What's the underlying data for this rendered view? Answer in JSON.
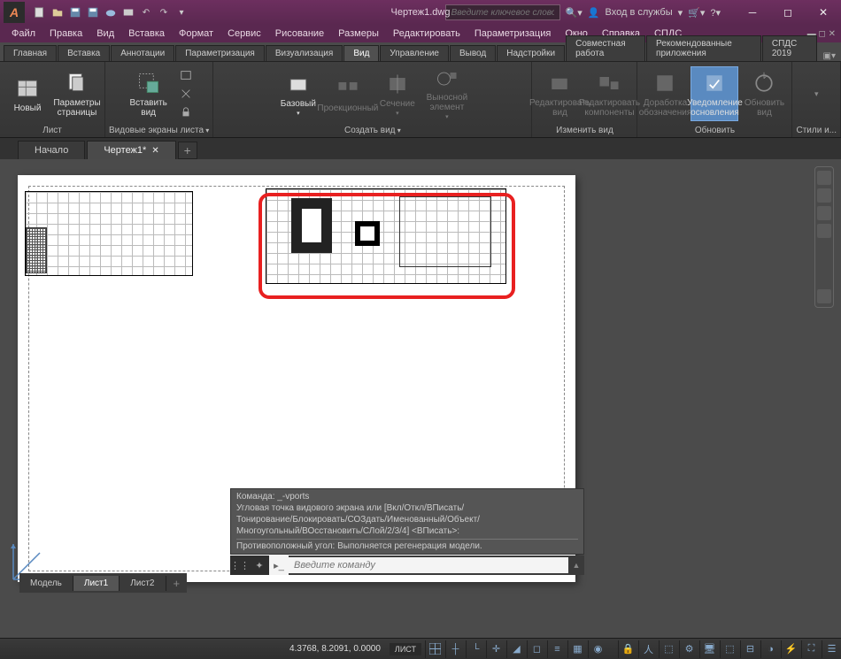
{
  "title": "Чертеж1.dwg",
  "search_placeholder": "Введите ключевое слово/фразу",
  "login_label": "Вход в службы",
  "menu": [
    "Файл",
    "Правка",
    "Вид",
    "Вставка",
    "Формат",
    "Сервис",
    "Рисование",
    "Размеры",
    "Редактировать",
    "Параметризация",
    "Окно",
    "Справка",
    "СПДС"
  ],
  "ribbon_tabs": [
    "Главная",
    "Вставка",
    "Аннотации",
    "Параметризация",
    "Визуализация",
    "Вид",
    "Управление",
    "Вывод",
    "Надстройки",
    "Совместная работа",
    "Рекомендованные приложения",
    "СПДС 2019"
  ],
  "ribbon_tabs_active_index": 5,
  "panels": {
    "sheet": {
      "title": "Лист",
      "btn_new": "Новый",
      "btn_page": "Параметры\nстраницы"
    },
    "vports": {
      "title": "Видовые экраны листа",
      "btn_insert": "Вставить вид"
    },
    "create": {
      "title": "Создать вид",
      "btn_base": "Базовый",
      "btn_proj": "Проекционный",
      "btn_section": "Сечение",
      "btn_detail": "Выносной элемент"
    },
    "modify": {
      "title": "Изменить вид",
      "btn_edit": "Редактировать\nвид",
      "btn_editcomp": "Редактировать\nкомпоненты"
    },
    "update": {
      "title": "Обновить",
      "btn_refine": "Доработка\nобозначения",
      "btn_notify": "Уведомление\nосновления",
      "btn_update": "Обновить\nвид"
    },
    "styles": {
      "title": "Стили и..."
    }
  },
  "doc_tabs": {
    "start": "Начало",
    "active": "Чертеж1*"
  },
  "cmd": {
    "l1": "Команда: _-vports",
    "l2": "Угловая точка видового экрана или [Вкл/Откл/ВПисать/",
    "l3": "Тонирование/Блокировать/СОЗдать/Именованный/Объект/",
    "l4": "Многоугольный/ВОсстановить/СЛой/2/3/4] <ВПисать>:",
    "l5": "Противоположный угол: Выполняется регенерация модели.",
    "placeholder": "Введите команду"
  },
  "layout_tabs": [
    "Модель",
    "Лист1",
    "Лист2"
  ],
  "layout_active_index": 1,
  "status": {
    "coords": "4.3768, 8.2091, 0.0000",
    "mode": "ЛИСТ"
  }
}
